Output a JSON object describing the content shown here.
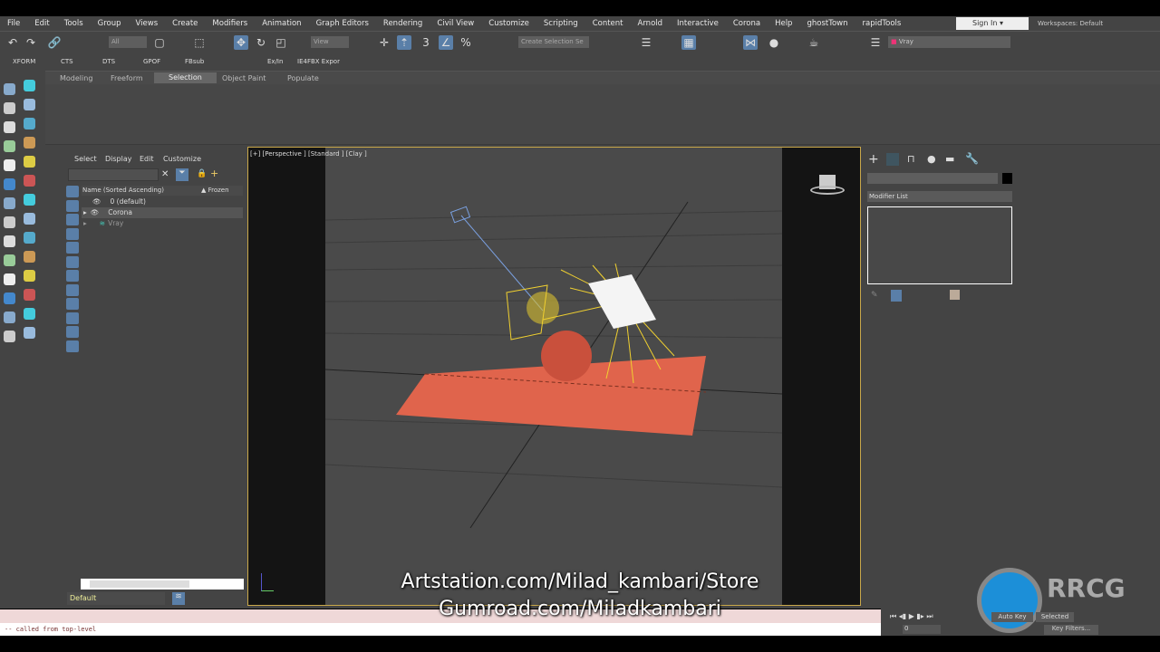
{
  "menu": [
    "File",
    "Edit",
    "Tools",
    "Group",
    "Views",
    "Create",
    "Modifiers",
    "Animation",
    "Graph Editors",
    "Rendering",
    "Civil View",
    "Customize",
    "Scripting",
    "Content",
    "Arnold",
    "Interactive",
    "Corona",
    "Help",
    "ghostTown",
    "rapidTools"
  ],
  "account": {
    "sign_in": "Sign In",
    "workspaces_label": "Workspaces:",
    "workspace": "Default"
  },
  "toolbar": {
    "selection_filter": "All",
    "ref_coord": "View",
    "named_selection": "Create Selection Se",
    "layer_dd": "Vray"
  },
  "row2": [
    "XFORM",
    "CTS",
    "DTS",
    "GPOF",
    "FBsub",
    "Ex/In",
    "IE4FBX Expor"
  ],
  "ribbon_tabs": [
    "Modeling",
    "Freeform",
    "Selection",
    "Object Paint",
    "Populate"
  ],
  "ribbon_active": "Selection",
  "explorer": {
    "menus": [
      "Select",
      "Display",
      "Edit",
      "Customize"
    ],
    "col_name": "Name (Sorted Ascending)",
    "col_frozen": "▲ Frozen",
    "rows": [
      {
        "name": "0 (default)"
      },
      {
        "name": "Corona"
      },
      {
        "name": "Vray"
      }
    ],
    "layer": "Default"
  },
  "viewport": {
    "label": "[+] [Perspective ] [Standard ] [Clay ]"
  },
  "command_panel": {
    "modifier_list": "Modifier List"
  },
  "listener": {
    "text": "-- called from top-level"
  },
  "anim": {
    "frame": "0",
    "auto_key": "Auto Key",
    "selected": "Selected",
    "key_filters": "Key Filters..."
  },
  "overlay": {
    "line1": "Artstation.com/Milad_kambari/Store",
    "line2": "Gumroad.com/Miladkambari",
    "logo": "RRCG 人人素材"
  },
  "colors": {
    "accent": "#5a7fa8",
    "plane": "#e0644c",
    "light": "#f0d030"
  }
}
